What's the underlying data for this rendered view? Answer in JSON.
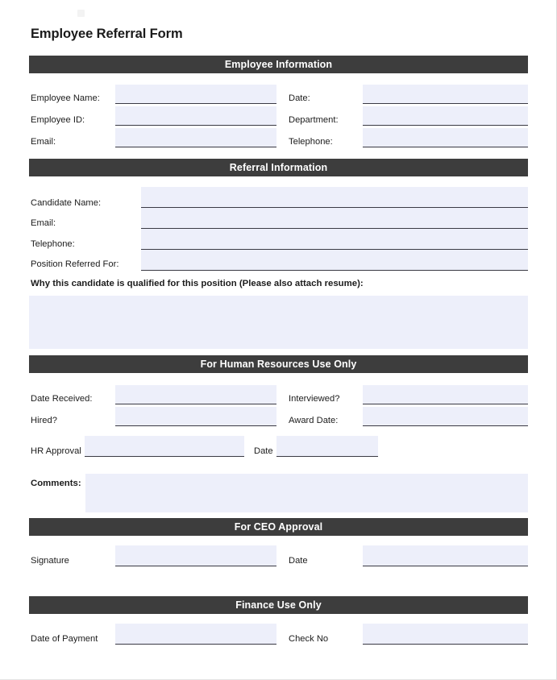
{
  "document": {
    "title": "Employee Referral Form",
    "colors": {
      "section_bar_bg": "#3d3d3d",
      "section_bar_text": "#ffffff",
      "field_fill": "#edeffa",
      "field_underline": "#3a3a44",
      "text": "#1c1c1c",
      "page_bg": "#ffffff"
    }
  },
  "sections": [
    {
      "id": "employee-information",
      "heading": "Employee Information",
      "fields": [
        {
          "label": "Employee Name:",
          "value": "",
          "placeholder": ""
        },
        {
          "label": "Date:",
          "value": "",
          "placeholder": ""
        },
        {
          "label": "Employee ID:",
          "value": "",
          "placeholder": ""
        },
        {
          "label": "Department:",
          "value": "",
          "placeholder": ""
        },
        {
          "label": "Email:",
          "value": "",
          "placeholder": ""
        },
        {
          "label": "Telephone:",
          "value": "",
          "placeholder": ""
        }
      ]
    },
    {
      "id": "referral-information",
      "heading": "Referral Information",
      "fields": [
        {
          "label": "Candidate Name:",
          "value": "",
          "placeholder": ""
        },
        {
          "label": "Email:",
          "value": "",
          "placeholder": ""
        },
        {
          "label": "Telephone:",
          "value": "",
          "placeholder": ""
        },
        {
          "label": "Position Referred For:",
          "value": "",
          "placeholder": ""
        }
      ],
      "qualification_prompt": "Why this candidate is qualified for this position (Please also attach resume):",
      "qualification_value": ""
    },
    {
      "id": "human-resources",
      "heading": "For Human Resources Use Only",
      "fields": [
        {
          "label": "Date Received:",
          "value": "",
          "placeholder": ""
        },
        {
          "label": "Interviewed?",
          "value": "",
          "placeholder": ""
        },
        {
          "label": "Hired?",
          "value": "",
          "placeholder": ""
        },
        {
          "label": "Award Date:",
          "value": "",
          "placeholder": ""
        },
        {
          "label": "HR Approval",
          "value": "",
          "placeholder": ""
        },
        {
          "label": "Date",
          "value": "",
          "placeholder": ""
        }
      ],
      "comments_label": "Comments:",
      "comments_value": ""
    },
    {
      "id": "ceo-approval",
      "heading": "For CEO Approval",
      "fields": [
        {
          "label": "Signature",
          "value": "",
          "placeholder": ""
        },
        {
          "label": "Date",
          "value": "",
          "placeholder": ""
        }
      ]
    },
    {
      "id": "finance",
      "heading": "Finance Use Only",
      "fields": [
        {
          "label": "Date of Payment",
          "value": "",
          "placeholder": ""
        },
        {
          "label": "Check No",
          "value": "",
          "placeholder": ""
        }
      ]
    }
  ]
}
